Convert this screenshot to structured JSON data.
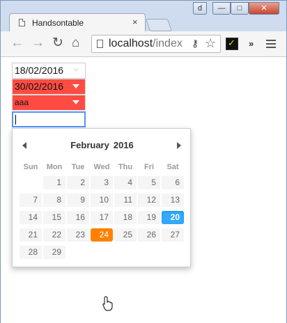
{
  "browser": {
    "tab_title": "Handsontable",
    "tab_close": "×",
    "window_buttons": [
      "d",
      "—",
      "□",
      "✕"
    ],
    "nav": {
      "back": "←",
      "forward": "→",
      "reload": "↻",
      "home": "⌂"
    },
    "url_host": "localhost",
    "url_rest": "/index",
    "key_icon": "⚷",
    "star_icon": "☆",
    "extensions_more": "»",
    "icons": [
      "page-icon",
      "key-icon",
      "star-icon",
      "extension-icon",
      "menu-icon"
    ]
  },
  "grid": {
    "cells": [
      {
        "value": "18/02/2016",
        "state": "valid"
      },
      {
        "value": "30/02/2016",
        "state": "invalid"
      },
      {
        "value": "aaa",
        "state": "invalid"
      }
    ],
    "editor_value": ""
  },
  "calendar": {
    "month": "February",
    "year": "2016",
    "weekdays": [
      "Sun",
      "Mon",
      "Tue",
      "Wed",
      "Thu",
      "Fri",
      "Sat"
    ],
    "first_weekday": 1,
    "days_in_month": 29,
    "selected_day": 20,
    "hovered_day": 24,
    "colors": {
      "selected": "#33aaff",
      "hover": "#ff8000",
      "invalid_cell": "#ff4c42"
    }
  }
}
